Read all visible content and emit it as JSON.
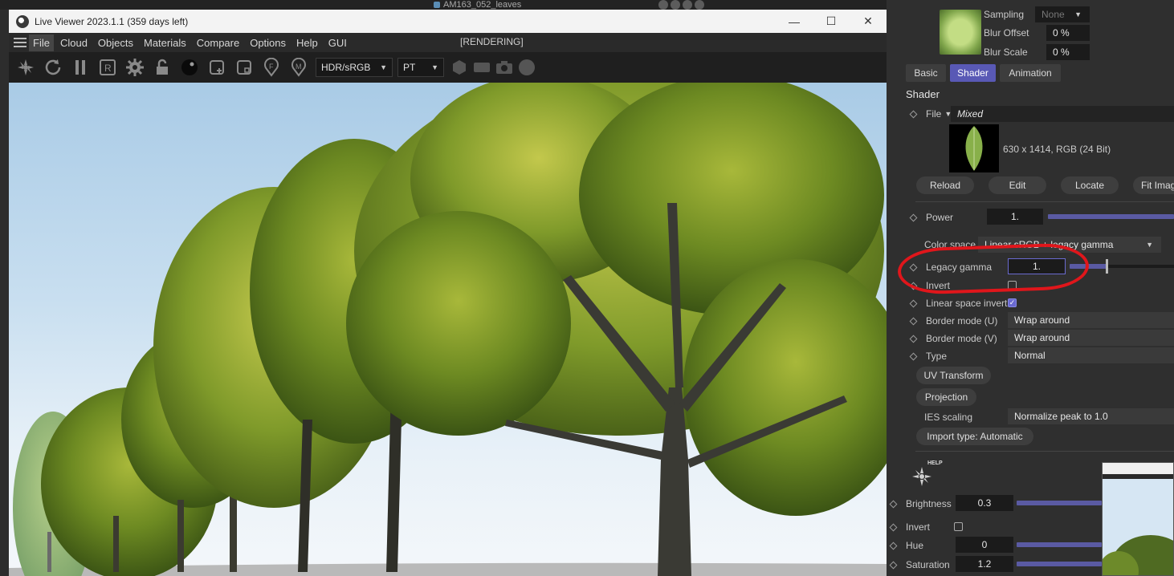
{
  "background_app": {
    "top_item": "AM163_052_leaves"
  },
  "window": {
    "title": "Live Viewer 2023.1.1 (359 days left)",
    "minimize": "—",
    "maximize": "☐",
    "close": "✕"
  },
  "menu": {
    "items": [
      "File",
      "Cloud",
      "Objects",
      "Materials",
      "Compare",
      "Options",
      "Help",
      "GUI"
    ],
    "status": "[RENDERING]"
  },
  "toolbar": {
    "icons": [
      "octane-icon",
      "refresh-icon",
      "pause-icon",
      "region-render-icon",
      "settings-gear-icon",
      "lock-icon",
      "material-sphere-icon",
      "add-region-icon",
      "film-region-icon",
      "focus-pick-icon",
      "material-pick-icon"
    ],
    "tonemap_select": "HDR/sRGB",
    "kernel_select": "PT"
  },
  "panel": {
    "sampling": {
      "label": "Sampling",
      "value": "None"
    },
    "blur_offset": {
      "label": "Blur Offset",
      "value": "0 %"
    },
    "blur_scale": {
      "label": "Blur Scale",
      "value": "0 %"
    },
    "tabs": [
      "Basic",
      "Shader",
      "Animation"
    ],
    "active_tab": "Shader",
    "section_title": "Shader",
    "file": {
      "label": "File",
      "value": "Mixed"
    },
    "image_info": "630 x 1414, RGB (24 Bit)",
    "buttons": [
      "Reload",
      "Edit",
      "Locate",
      "Fit Imag"
    ],
    "power": {
      "label": "Power",
      "value": "1."
    },
    "color_space": {
      "label": "Color space",
      "value": "Linear sRGB + legacy gamma"
    },
    "legacy_gamma": {
      "label": "Legacy gamma",
      "value": "1."
    },
    "invert": {
      "label": "Invert"
    },
    "linear_space_invert": {
      "label": "Linear space invert"
    },
    "border_u": {
      "label": "Border mode (U)",
      "value": "Wrap around"
    },
    "border_v": {
      "label": "Border mode (V)",
      "value": "Wrap around"
    },
    "type": {
      "label": "Type",
      "value": "Normal"
    },
    "uv_transform": "UV Transform",
    "projection": "Projection",
    "ies_scaling": {
      "label": "IES scaling",
      "value": "Normalize peak to 1.0"
    },
    "import_type": "Import type: Automatic",
    "help_label": "HELP",
    "brightness": {
      "label": "Brightness",
      "value": "0.3"
    },
    "invert2": {
      "label": "Invert"
    },
    "hue": {
      "label": "Hue",
      "value": "0"
    },
    "saturation": {
      "label": "Saturation",
      "value": "1.2"
    }
  },
  "colors": {
    "accent": "#5959b5",
    "annotation": "#e0161b"
  }
}
